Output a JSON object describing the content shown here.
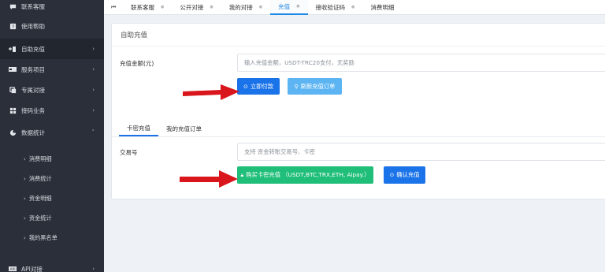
{
  "sidebar": {
    "items": [
      {
        "label": "联系客服",
        "icon": "chat-icon"
      },
      {
        "label": "使用帮助",
        "icon": "help-icon"
      },
      {
        "label": "自助充值",
        "icon": "recharge-icon"
      },
      {
        "label": "服务项目",
        "icon": "card-icon"
      },
      {
        "label": "专属对接",
        "icon": "link-icon"
      },
      {
        "label": "接码业务",
        "icon": "grid-icon"
      },
      {
        "label": "数据统计",
        "icon": "stats-icon"
      }
    ],
    "sub_items": [
      {
        "label": "消费明细"
      },
      {
        "label": "消费统计"
      },
      {
        "label": "资金明细"
      },
      {
        "label": "资金统计"
      },
      {
        "label": "我的黑名单"
      }
    ],
    "last_item": {
      "label": "API对接",
      "icon": "api-icon"
    }
  },
  "topbar": {
    "tabs": [
      {
        "label": "联系客服"
      },
      {
        "label": "公开对接"
      },
      {
        "label": "我的对接"
      },
      {
        "label": "充值"
      },
      {
        "label": "接收验证码"
      },
      {
        "label": "消费明细"
      }
    ]
  },
  "panel": {
    "title": "自助充值",
    "amount_label": "充值金额(元)",
    "amount_placeholder": "输入充值金额，USDT-TRC20支付，无奖励",
    "pay_now_label": "立即付款",
    "refresh_label": "刷新充值订单",
    "sub_tabs": [
      {
        "label": "卡密充值"
      },
      {
        "label": "我的充值订单"
      }
    ],
    "tx_label": "交易号",
    "tx_placeholder": "支持 资金转账交易号、卡密",
    "buy_card_label": "购买卡密充值 （USDT,BTC,TRX,ETH, Aipay.）",
    "confirm_label": "确认充值"
  },
  "colors": {
    "sidebar_bg": "#2b2f3a",
    "accent_blue": "#1a73e8",
    "light_blue": "#5db4f2",
    "green": "#1fbe79",
    "arrow_red": "#d9161c"
  }
}
